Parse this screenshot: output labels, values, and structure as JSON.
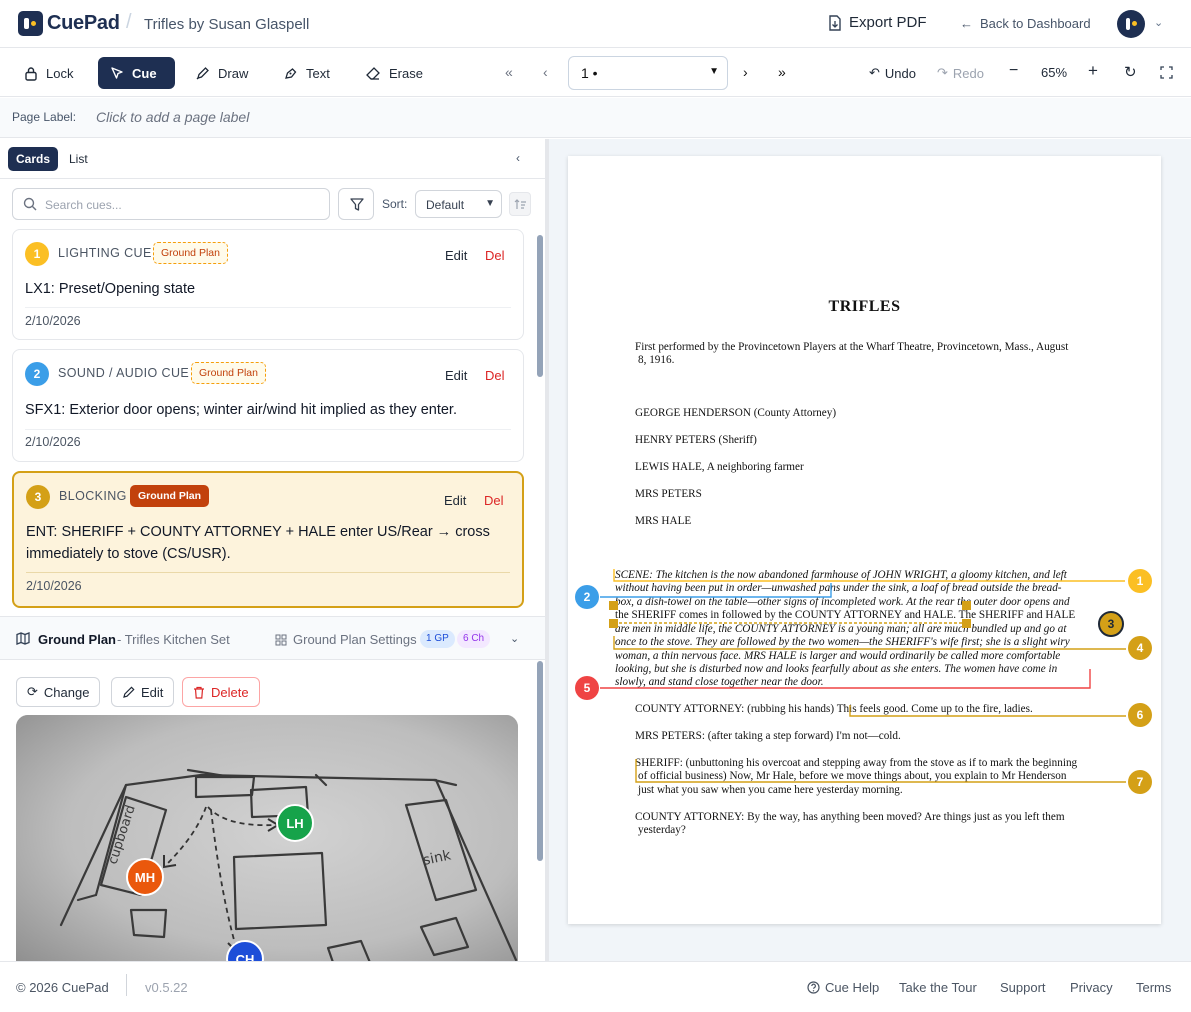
{
  "app": {
    "name": "CuePad",
    "document_title": "Trifles by Susan Glaspell"
  },
  "header": {
    "export_label": "Export PDF",
    "back_label": "Back to Dashboard"
  },
  "toolbar": {
    "tools": [
      "Lock",
      "Cue",
      "Draw",
      "Text",
      "Erase"
    ],
    "active_tool": "Cue",
    "page_select": "1 •",
    "undo": "Undo",
    "redo": "Redo",
    "zoom": "65%"
  },
  "page_label": {
    "label": "Page Label:",
    "placeholder": "Click to add a page label"
  },
  "left_panel": {
    "view_tabs": [
      "Cards",
      "List"
    ],
    "search_placeholder": "Search cues...",
    "sort_label": "Sort:",
    "sort_value": "Default",
    "cards": [
      {
        "num": "1",
        "type": "LIGHTING CUE",
        "tag": "Ground Plan",
        "text": "LX1: Preset/Opening state",
        "date": "2/10/2026",
        "color": "#fbbf24",
        "edit": "Edit",
        "del": "Del"
      },
      {
        "num": "2",
        "type": "SOUND / AUDIO CUE",
        "tag": "Ground Plan",
        "text": "SFX1: Exterior door opens; winter air/wind hit implied as they enter.",
        "date": "2/10/2026",
        "color": "#3b9ee8",
        "edit": "Edit",
        "del": "Del"
      },
      {
        "num": "3",
        "type": "BLOCKING",
        "tag": "Ground Plan",
        "text": "ENT: SHERIFF + COUNTY ATTORNEY + HALE enter US/Rear → cross immediately to stove (CS/USR).",
        "date": "2/10/2026",
        "color": "#d4a017",
        "edit": "Edit",
        "del": "Del"
      }
    ]
  },
  "ground_plan": {
    "title": "Ground Plan",
    "subtitle": "- Trifles Kitchen Set",
    "settings_label": "Ground Plan Settings",
    "gp_count": "1 GP",
    "ch_count": "6 Ch",
    "buttons": {
      "change": "Change",
      "edit": "Edit",
      "delete": "Delete"
    },
    "sketch_labels": {
      "cupboard": "cupboard",
      "sink": "sink"
    },
    "characters": [
      {
        "initials": "LH",
        "color": "#16a34a"
      },
      {
        "initials": "MH",
        "color": "#ea580c"
      },
      {
        "initials": "CH",
        "color": "#1d4ed8"
      }
    ]
  },
  "script_page": {
    "title": "TRIFLES",
    "lines": [
      "First performed by the Provincetown Players at the Wharf Theatre, Provincetown, Mass., August",
      "8, 1916.",
      "GEORGE HENDERSON (County Attorney)",
      "HENRY PETERS (Sheriff)",
      "LEWIS HALE, A neighboring farmer",
      "MRS PETERS",
      "MRS HALE",
      "SCENE: The kitchen is the now abandoned farmhouse of JOHN WRIGHT, a gloomy kitchen, and left",
      "without having been put in order—unwashed pans under the sink, a loaf of bread outside the bread-",
      "box, a dish-towel on the table—other signs of incompleted work. At the rear the outer door opens and",
      "the SHERIFF comes in followed by the COUNTY ATTORNEY and HALE. The SHERIFF and HALE",
      "are men in middle life, the COUNTY ATTORNEY is a young man; all are much bundled up and go at",
      "once to the stove. They are followed by the two women—the SHERIFF's wife first; she is a slight wiry",
      "woman, a thin nervous face. MRS HALE is larger and would ordinarily be called more comfortable",
      "looking, but she is disturbed now and looks fearfully about as she enters. The women have come in",
      "slowly, and stand close together near the door.",
      "COUNTY ATTORNEY: (rubbing his hands) This feels good. Come up to the fire, ladies.",
      "MRS PETERS: (after taking a step forward) I'm not—cold.",
      "SHERIFF: (unbuttoning his overcoat and stepping away from the stove as if to mark the beginning",
      "of official business) Now, Mr Hale, before we move things about, you explain to Mr Henderson",
      "just what you saw when you came here yesterday morning.",
      "COUNTY ATTORNEY: By the way, has anything been moved? Are things just as you left them",
      "yesterday?"
    ],
    "markers": [
      {
        "num": "1",
        "color": "#fbbf24"
      },
      {
        "num": "2",
        "color": "#3b9ee8"
      },
      {
        "num": "3",
        "color": "#d4a017"
      },
      {
        "num": "4",
        "color": "#d4a017"
      },
      {
        "num": "5",
        "color": "#ef4444"
      },
      {
        "num": "6",
        "color": "#d4a017"
      },
      {
        "num": "7",
        "color": "#d4a017"
      }
    ]
  },
  "footer": {
    "copyright": "© 2026 CuePad",
    "version": "v0.5.22",
    "links": [
      "Cue Help",
      "Take the Tour",
      "Support",
      "Privacy",
      "Terms"
    ]
  }
}
